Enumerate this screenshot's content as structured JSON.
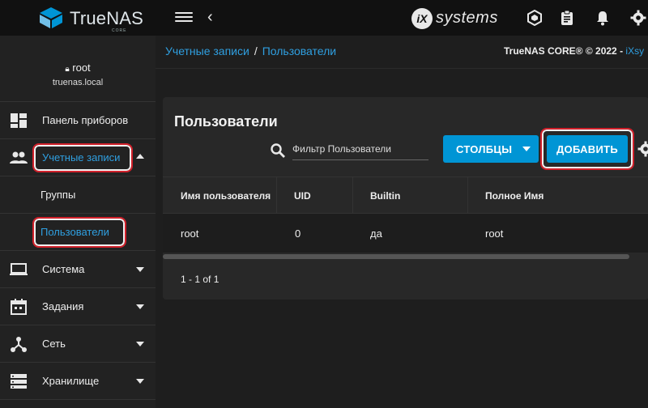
{
  "topbar": {
    "brand_name": "TrueNAS",
    "brand_sub": "CORE",
    "vendor": "systems",
    "vendor_mark": "iX"
  },
  "user": {
    "name": "root",
    "host": "truenas.local"
  },
  "sidebar": {
    "items": [
      {
        "label": "Панель приборов",
        "icon": "dashboard-icon"
      },
      {
        "label": "Учетные записи",
        "icon": "accounts-icon"
      },
      {
        "label": "Группы"
      },
      {
        "label": "Пользователи"
      },
      {
        "label": "Система",
        "icon": "computer-icon"
      },
      {
        "label": "Задания",
        "icon": "calendar-icon"
      },
      {
        "label": "Сеть",
        "icon": "network-icon"
      },
      {
        "label": "Хранилище",
        "icon": "storage-icon"
      }
    ]
  },
  "breadcrumb": {
    "parent": "Учетные записи",
    "separator": "/",
    "current": "Пользователи"
  },
  "copyright": {
    "text": "TrueNAS CORE® © 2022 - ",
    "link": "iXsy"
  },
  "card": {
    "title": "Пользователи",
    "filter_placeholder": "Фильтр Пользователи",
    "columns_button": "СТОЛБЦЫ",
    "add_button": "ДОБАВИТЬ"
  },
  "table": {
    "headers": [
      "Имя пользователя",
      "UID",
      "Builtin",
      "Полное Имя"
    ],
    "rows": [
      [
        "root",
        "0",
        "да",
        "root"
      ]
    ]
  },
  "pager": "1 - 1 of 1",
  "colors": {
    "accent": "#0095d5",
    "link": "#2f9fe0",
    "highlight": "#d0202a"
  }
}
